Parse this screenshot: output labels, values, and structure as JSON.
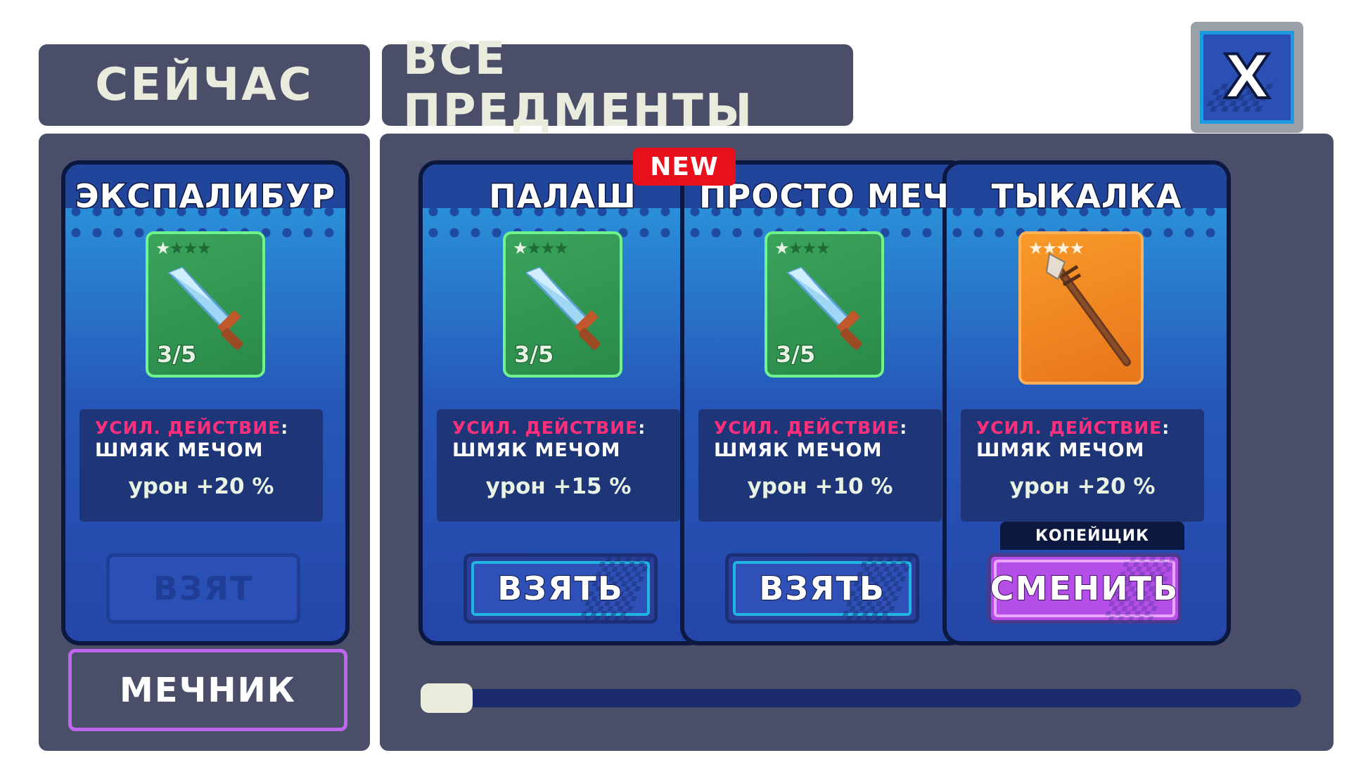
{
  "header": {
    "now_tab": "СЕЙЧАС",
    "all_items_tab": "ВСЕ ПРЕДМЕНТЫ",
    "close_label": "X"
  },
  "current": {
    "card": {
      "name": "ЭКСПАЛИБУР",
      "stars": 1,
      "max_stars": 4,
      "icon": "sword-icon",
      "count": "3/5",
      "action_label": "УСИЛ. ДЕЙСТВИЕ",
      "colon": ":",
      "skill": "ШМЯК МЕЧОМ",
      "damage": "урон +20 %",
      "button": "ВЗЯТ"
    },
    "class_button": "МЕЧНИК"
  },
  "items": [
    {
      "name": "ПАЛАШ",
      "badge": "NEW",
      "stars": 1,
      "max_stars": 4,
      "icon": "sword-icon",
      "count": "3/5",
      "action_label": "УСИЛ. ДЕЙСТВИЕ",
      "colon": ":",
      "skill": "ШМЯК МЕЧОМ",
      "damage": "урон +15 %",
      "button": "ВЗЯТЬ"
    },
    {
      "name": "ПРОСТО МЕЧ",
      "stars": 1,
      "max_stars": 4,
      "icon": "sword-icon",
      "count": "3/5",
      "action_label": "УСИЛ. ДЕЙСТВИЕ",
      "colon": ":",
      "skill": "ШМЯК МЕЧОМ",
      "damage": "урон +10 %",
      "button": "ВЗЯТЬ"
    },
    {
      "name": "ТЫКАЛКА",
      "stars": 4,
      "max_stars": 4,
      "icon": "spear-icon",
      "action_label": "УСИЛ. ДЕЙСТВИЕ",
      "colon": ":",
      "skill": "ШМЯК МЕЧОМ",
      "damage": "урон +20 %",
      "class_tag": "КОПЕЙЩИК",
      "button": "СМЕНИТЬ"
    }
  ],
  "scroll": {
    "position": 0.0
  },
  "colors": {
    "panel": "#4a4e69",
    "tab_text": "#e9ecdc",
    "action_text": "#ff2f7b",
    "common_item": "#2a8a49",
    "rare_item": "#e8751a",
    "change_button": "#b54ee8",
    "new_badge": "#e8111b"
  }
}
